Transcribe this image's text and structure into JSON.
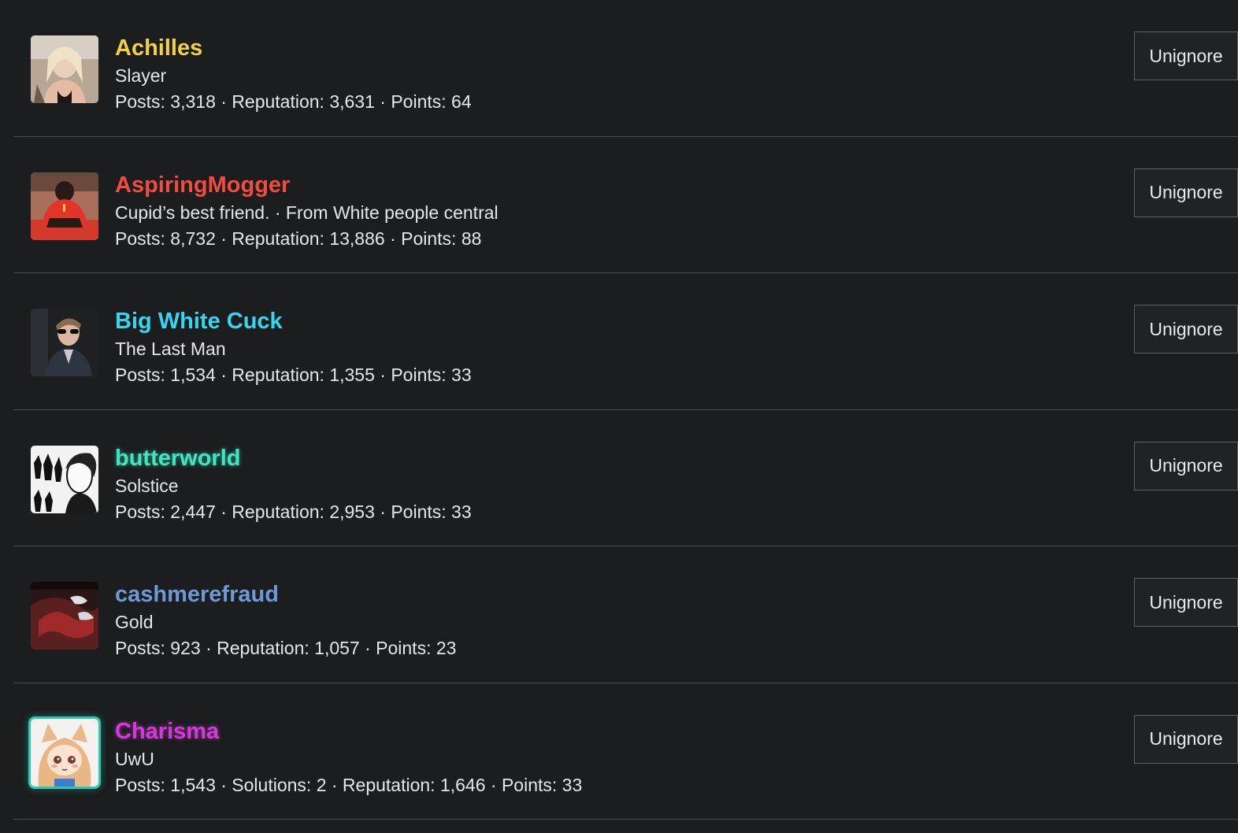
{
  "users": [
    {
      "name": "Achilles",
      "color": "#f5d13b",
      "title": "Slayer",
      "stats": "Posts: 3,318 · Reputation: 3,631 · Points: 64",
      "button": "Unignore"
    },
    {
      "name": "AspiringMogger",
      "color": "#f24b3f",
      "title": "Cupid’s best friend. · From White people central",
      "stats": "Posts: 8,732 · Reputation: 13,886 · Points: 88",
      "button": "Unignore"
    },
    {
      "name": "Big White Cuck",
      "color": "#36d6f0",
      "title": "The Last Man",
      "stats": "Posts: 1,534 · Reputation: 1,355 · Points: 33",
      "button": "Unignore"
    },
    {
      "name": "butterworld",
      "color": "#3fe6c1",
      "title": "Solstice",
      "stats": "Posts: 2,447 · Reputation: 2,953 · Points: 33",
      "button": "Unignore"
    },
    {
      "name": "cashmerefraud",
      "color": "#6d9ad6",
      "title": "Gold",
      "stats": "Posts: 923 · Reputation: 1,057 · Points: 23",
      "button": "Unignore"
    },
    {
      "name": "Charisma",
      "color": "#d43ad8",
      "title": "UwU",
      "stats": "Posts: 1,543 · Solutions: 2 · Reputation: 1,646 · Points: 33",
      "button": "Unignore"
    }
  ]
}
